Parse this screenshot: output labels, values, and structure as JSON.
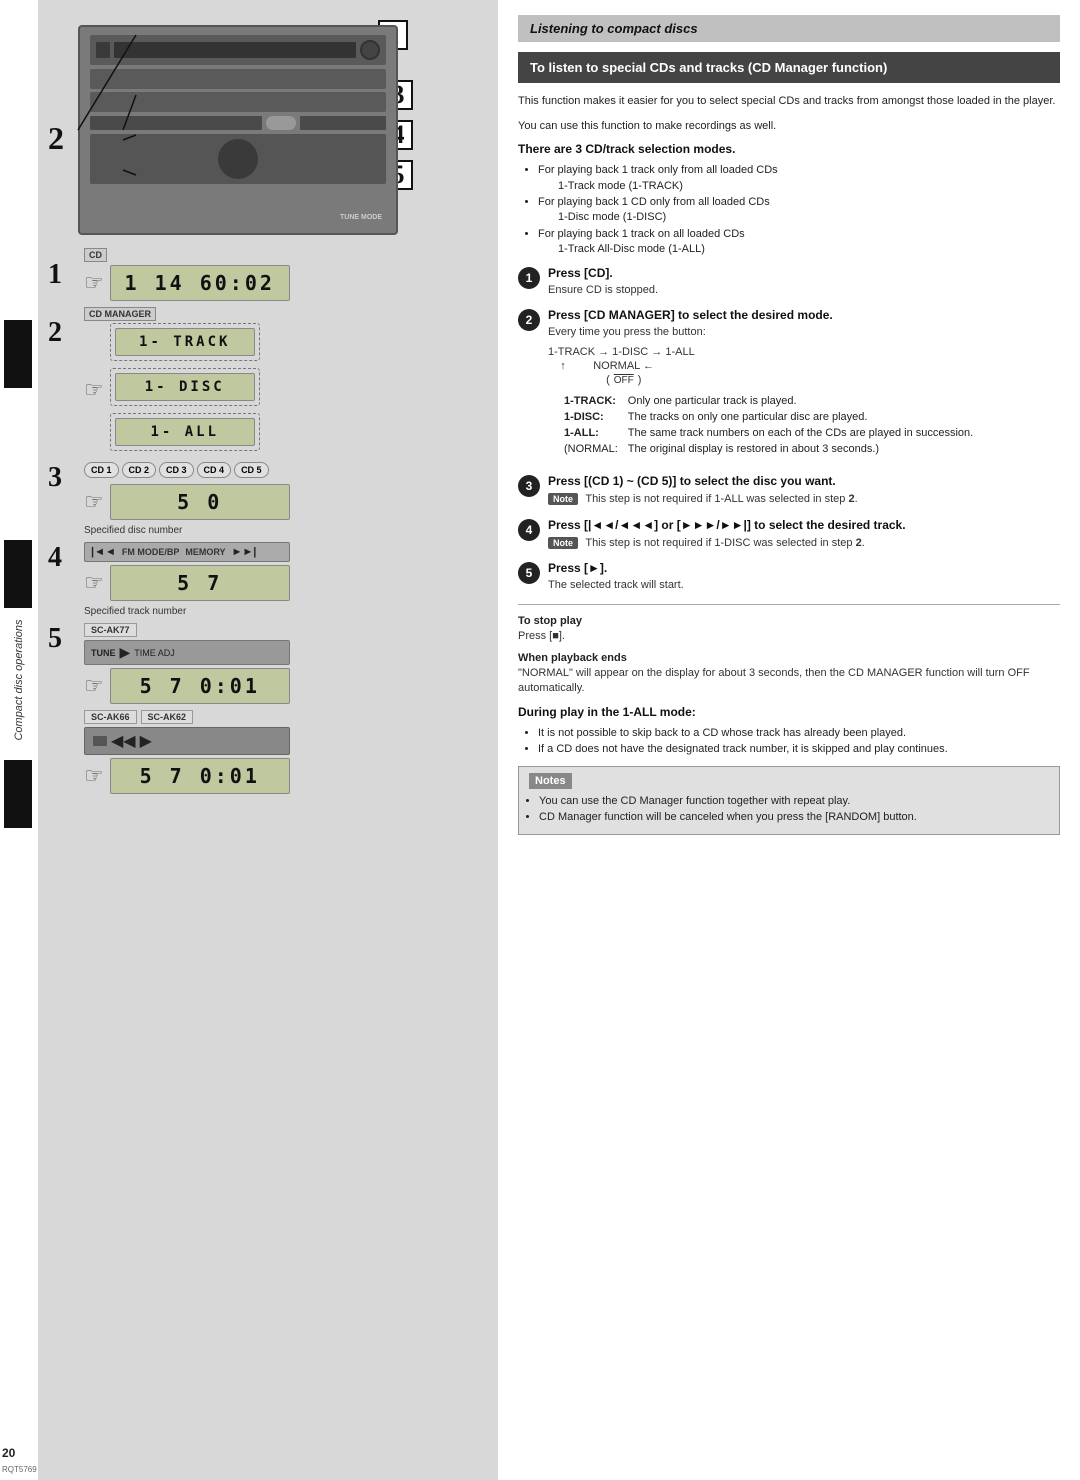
{
  "page": {
    "number": "20",
    "doc_code": "RQT5769"
  },
  "sidebar": {
    "rotated_text": "Compact disc operations"
  },
  "left_panel": {
    "step_labels": [
      "2",
      "1",
      "2",
      "3",
      "4",
      "5"
    ],
    "displays": {
      "main_top": "1  14  60:02",
      "track_display": "1- TRACK",
      "disc_display": "1- DISC",
      "all_display": "1- ALL",
      "disc_num": "5  0",
      "track_num": "5  7",
      "sc_ak77_display": "5  7  0:01",
      "sc_ak66_62_display": "5  7  0:01"
    },
    "labels": {
      "specified_disc": "Specified disc number",
      "specified_track": "Specified track number",
      "sc_ak77": "SC-AK77",
      "sc_ak66": "SC-AK66",
      "sc_ak62": "SC-AK62",
      "cd_label": "CD",
      "cd_manager_label": "CD MANAGER"
    },
    "cd_buttons": [
      "CD 1",
      "CD 2",
      "CD 3",
      "CD 4",
      "CD 5"
    ],
    "control_labels": [
      "FM MODE/BP",
      "MEMORY"
    ]
  },
  "right_panel": {
    "section_header": "Listening to compact discs",
    "main_title": "To listen to special CDs and tracks (CD Manager function)",
    "intro_text": "This function makes it easier for you to select special CDs and tracks from amongst those loaded in the player.",
    "extra_text": "You can use this function to make recordings as well.",
    "modes_title": "There are 3 CD/track selection modes.",
    "modes_bullets": [
      "For playing back 1 track only from all loaded CDs",
      "1-Track mode (1-TRACK)",
      "For playing back 1 CD only from all loaded CDs",
      "1-Disc mode (1-DISC)",
      "For playing back 1 track on all loaded CDs",
      "1-Track All-Disc mode (1-ALL)"
    ],
    "steps": [
      {
        "number": "1",
        "title": "Press [CD].",
        "sub": "Ensure CD is stopped."
      },
      {
        "number": "2",
        "title": "Press [CD MANAGER] to select the desired mode.",
        "sub": "Every time you press the button:"
      },
      {
        "number": "3",
        "title": "Press [(CD 1) ~ (CD 5)] to select the disc you want.",
        "note_label": "Note",
        "note_text": "This step is not required if 1-ALL was selected in step 2."
      },
      {
        "number": "4",
        "title": "Press [|◄◄/◄◄◄] or [►►►/►►|] to select the desired track.",
        "note_label": "Note",
        "note_text": "This step is not required if 1-DISC was selected in step 2."
      },
      {
        "number": "5",
        "title": "Press [►].",
        "sub": "The selected track will start."
      }
    ],
    "track_flow": {
      "line1": "1-TRACK → 1-DISC → 1-ALL",
      "line2": "↑         NORMAL ←",
      "line3": "              (OFF)"
    },
    "track_table": {
      "headers": [],
      "rows": [
        [
          "1-TRACK:",
          "Only one particular track is played."
        ],
        [
          "1-DISC:",
          "The tracks on only one particular disc are played."
        ],
        [
          "1-ALL:",
          "The same track numbers on each of the CDs are played in succession."
        ],
        [
          "(NORMAL:",
          "The original display is restored in about 3 seconds.)"
        ]
      ]
    },
    "stop_section": {
      "title": "To stop play",
      "text": "Press [■]."
    },
    "playback_section": {
      "title": "When playback ends",
      "text": "\"NORMAL\" will appear on the display for about 3 seconds, then the CD MANAGER function will turn OFF automatically."
    },
    "during_play": {
      "title": "During play in the 1-ALL mode:",
      "bullets": [
        "It is not possible to skip back to a CD whose track has already been played.",
        "If a CD does not have the designated track number, it is skipped and play continues."
      ]
    },
    "notes": {
      "header": "Notes",
      "items": [
        "You can use the CD Manager function together with repeat play.",
        "CD Manager function will be canceled when you press the [RANDOM] button."
      ]
    }
  }
}
